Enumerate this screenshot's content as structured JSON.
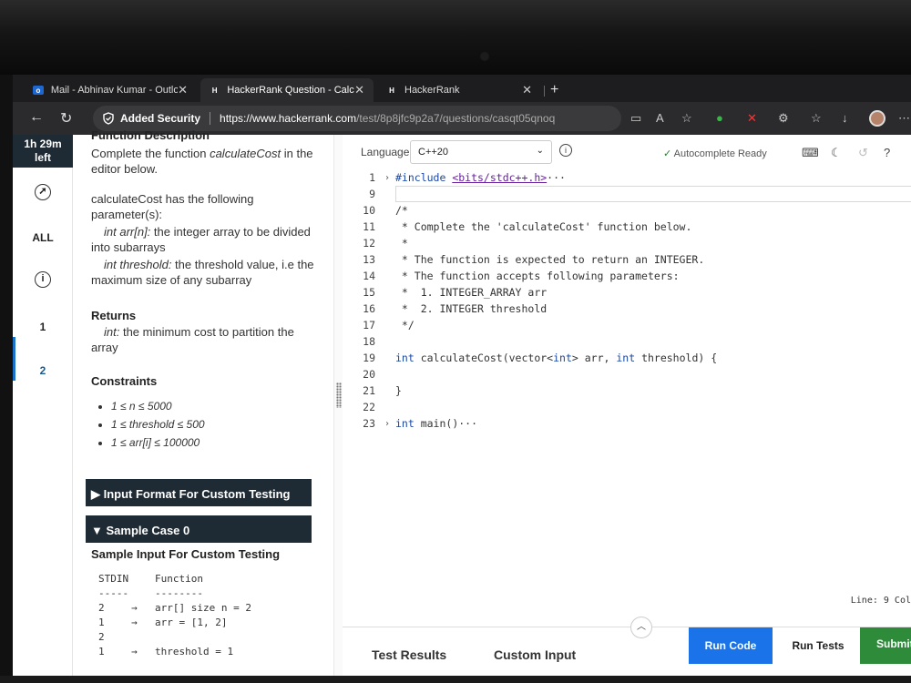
{
  "browser": {
    "tabs": [
      {
        "title": "Mail - Abhinav Kumar - Outlo",
        "icon": "mail-icon",
        "active": false
      },
      {
        "title": "HackerRank Question - Calcul",
        "icon": "hackerrank-icon",
        "active": true
      },
      {
        "title": "HackerRank",
        "icon": "hackerrank-icon",
        "active": false
      }
    ],
    "security_label": "Added Security",
    "url_host": "https://www.hackerrank.com",
    "url_path": "/test/8p8jfc9p2a7/questions/casqt05qnoq"
  },
  "leftnav": {
    "timer_line1": "1h 29m",
    "timer_line2": "left",
    "all_label": "ALL",
    "q1": "1",
    "q2": "2"
  },
  "description": {
    "heading": "Function Description",
    "intro_pre": "Complete the function ",
    "intro_fn": "calculateCost",
    "intro_post": " in the editor below.",
    "params_intro": "calculateCost has the following parameter(s):",
    "param1_name": "int arr[n]:",
    "param1_desc": " the integer array to be divided into subarrays",
    "param2_name": "int threshold:",
    "param2_desc": " the threshold value, i.e the maximum size of any subarray",
    "returns_heading": "Returns",
    "returns_name": "int:",
    "returns_desc": " the minimum cost to partition the array",
    "constraints_heading": "Constraints",
    "constraints": [
      "1 ≤ n ≤ 5000",
      "1 ≤ threshold ≤ 500",
      "1 ≤ arr[i] ≤ 100000"
    ],
    "input_format_label": "▶ Input Format For Custom Testing",
    "sample_case_label": "▼ Sample Case 0",
    "sample_input_heading": "Sample Input For Custom Testing",
    "stdin_header": [
      "STDIN",
      "Function"
    ],
    "stdin_sep": [
      "-----",
      "--------"
    ],
    "stdin_rows": [
      {
        "stdin": "2",
        "arrow": "→",
        "fn": "arr[] size n = 2"
      },
      {
        "stdin": "1",
        "arrow": "→",
        "fn": "arr = [1, 2]"
      },
      {
        "stdin": "2",
        "arrow": "",
        "fn": ""
      },
      {
        "stdin": "1",
        "arrow": "→",
        "fn": "threshold = 1"
      }
    ]
  },
  "editor": {
    "language_label": "Language",
    "language_value": "C++20",
    "autocomplete": "Autocomplete Ready",
    "status_line": "Line: 9 Col",
    "lines": [
      {
        "n": "1",
        "fold": "›",
        "text": "#include <bits/stdc++.h>···"
      },
      {
        "n": "9",
        "fold": "",
        "text": ""
      },
      {
        "n": "10",
        "fold": "",
        "text": "/*"
      },
      {
        "n": "11",
        "fold": "",
        "text": " * Complete the 'calculateCost' function below."
      },
      {
        "n": "12",
        "fold": "",
        "text": " *"
      },
      {
        "n": "13",
        "fold": "",
        "text": " * The function is expected to return an INTEGER."
      },
      {
        "n": "14",
        "fold": "",
        "text": " * The function accepts following parameters:"
      },
      {
        "n": "15",
        "fold": "",
        "text": " *  1. INTEGER_ARRAY arr"
      },
      {
        "n": "16",
        "fold": "",
        "text": " *  2. INTEGER threshold"
      },
      {
        "n": "17",
        "fold": "",
        "text": " */"
      },
      {
        "n": "18",
        "fold": "",
        "text": ""
      },
      {
        "n": "19",
        "fold": "",
        "text": "int calculateCost(vector<int> arr, int threshold) {"
      },
      {
        "n": "20",
        "fold": "",
        "text": ""
      },
      {
        "n": "21",
        "fold": "",
        "text": "}"
      },
      {
        "n": "22",
        "fold": "",
        "text": ""
      },
      {
        "n": "23",
        "fold": "›",
        "text": "int main()···"
      }
    ],
    "bottom": {
      "test_results": "Test Results",
      "custom_input": "Custom Input",
      "run_code": "Run Code",
      "run_tests": "Run Tests",
      "submit": "Submit"
    }
  },
  "colors": {
    "run_code": "#1a73e8",
    "submit": "#2e8b3a",
    "dark_bar": "#1e2a34"
  }
}
